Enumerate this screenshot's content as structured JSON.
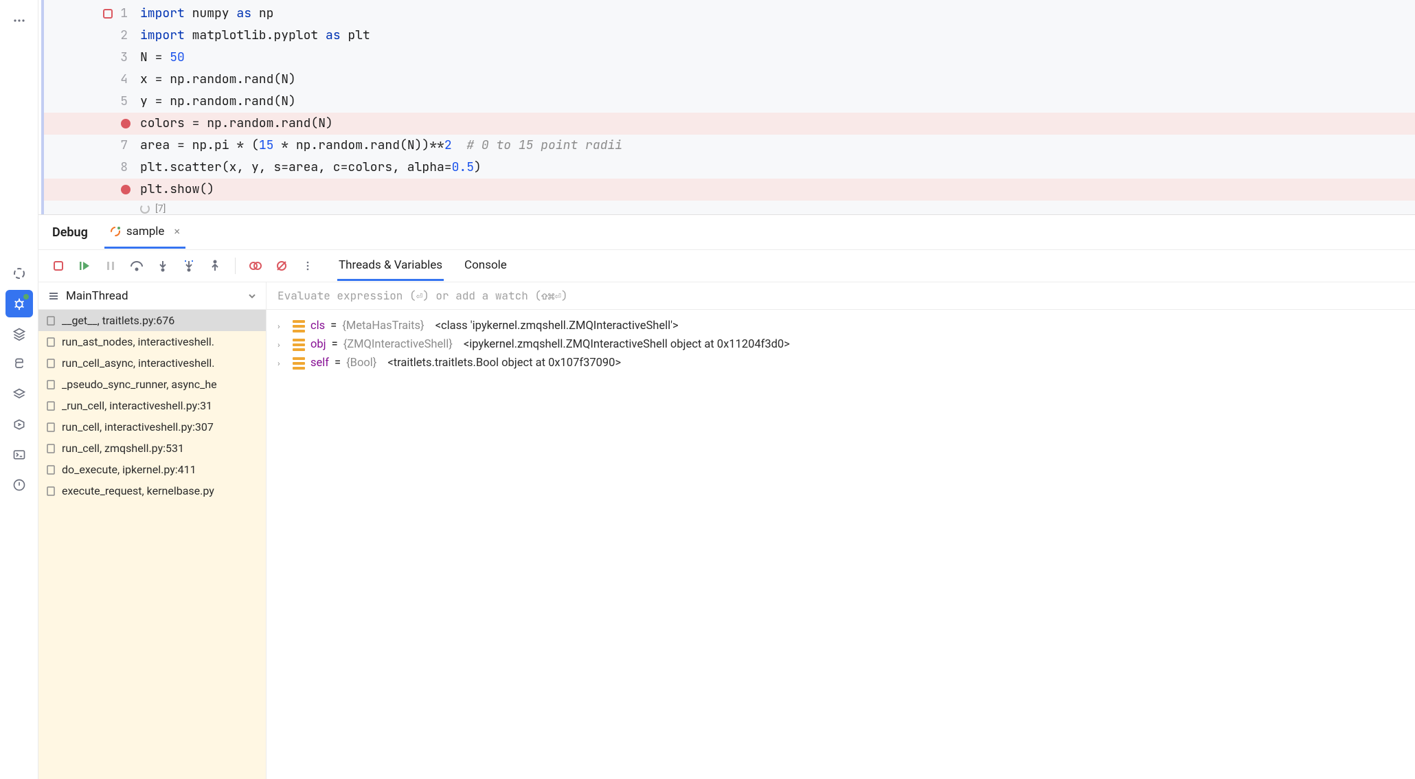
{
  "editor": {
    "cell_exec_indicator": "[7]",
    "lines": [
      {
        "n": 1,
        "bp": "empty",
        "tokens": [
          [
            "kw",
            "import"
          ],
          [
            "",
            " numpy "
          ],
          [
            "kw",
            "as"
          ],
          [
            "",
            " np"
          ]
        ]
      },
      {
        "n": 2,
        "tokens": [
          [
            "kw",
            "import"
          ],
          [
            "",
            " matplotlib.pyplot "
          ],
          [
            "kw",
            "as"
          ],
          [
            "",
            " plt"
          ]
        ]
      },
      {
        "n": 3,
        "tokens": [
          [
            "",
            "N = "
          ],
          [
            "num",
            "50"
          ]
        ]
      },
      {
        "n": 4,
        "tokens": [
          [
            "",
            "x = np.random.rand(N)"
          ]
        ]
      },
      {
        "n": 5,
        "tokens": [
          [
            "",
            "y = np.random.rand(N)"
          ]
        ]
      },
      {
        "n": null,
        "bp": "set",
        "hl": true,
        "tokens": [
          [
            "",
            "colors = np.random.rand(N)"
          ]
        ]
      },
      {
        "n": 7,
        "tokens": [
          [
            "",
            "area = np.pi * ("
          ],
          [
            "num",
            "15"
          ],
          [
            "",
            " * np.random.rand(N))**"
          ],
          [
            "num",
            "2"
          ],
          [
            "",
            "  "
          ],
          [
            "com",
            "# 0 to 15 point radii"
          ]
        ]
      },
      {
        "n": 8,
        "tokens": [
          [
            "",
            "plt.scatter(x, y, s=area, c=colors, alpha="
          ],
          [
            "num",
            "0.5"
          ],
          [
            "",
            ")"
          ]
        ]
      },
      {
        "n": null,
        "bp": "set",
        "hl": true,
        "tokens": [
          [
            "",
            "plt.show()"
          ]
        ]
      }
    ]
  },
  "debug": {
    "panel_label": "Debug",
    "file_tab": "sample",
    "inner_tabs": {
      "threads": "Threads & Variables",
      "console": "Console"
    },
    "thread_selector": "MainThread",
    "eval_placeholder": "Evaluate expression (⏎) or add a watch (⇧⌘⏎)",
    "frames": [
      {
        "label": "__get__, traitlets.py:676",
        "selected": true
      },
      {
        "label": "run_ast_nodes, interactiveshell."
      },
      {
        "label": "run_cell_async, interactiveshell."
      },
      {
        "label": "_pseudo_sync_runner, async_he"
      },
      {
        "label": "_run_cell, interactiveshell.py:31"
      },
      {
        "label": "run_cell, interactiveshell.py:307"
      },
      {
        "label": "run_cell, zmqshell.py:531"
      },
      {
        "label": "do_execute, ipkernel.py:411"
      },
      {
        "label": "execute_request, kernelbase.py"
      }
    ],
    "variables": [
      {
        "name": "cls",
        "type": "{MetaHasTraits}",
        "value": "<class 'ipykernel.zmqshell.ZMQInteractiveShell'>"
      },
      {
        "name": "obj",
        "type": "{ZMQInteractiveShell}",
        "value": "<ipykernel.zmqshell.ZMQInteractiveShell object at 0x11204f3d0>"
      },
      {
        "name": "self",
        "type": "{Bool}",
        "value": "<traitlets.traitlets.Bool object at 0x107f37090>"
      }
    ]
  }
}
